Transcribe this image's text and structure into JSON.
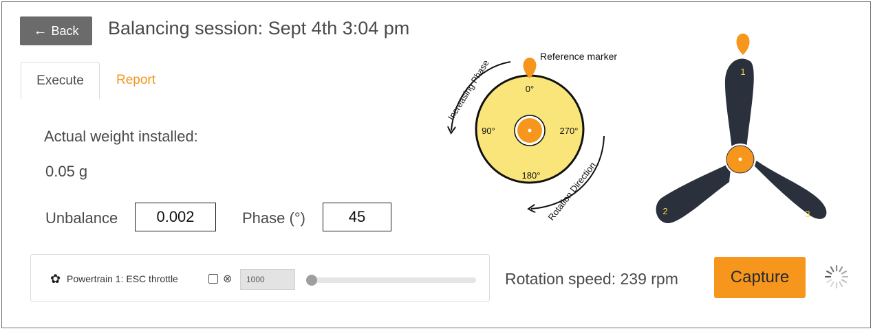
{
  "header": {
    "back_label": "Back",
    "title": "Balancing session: Sept 4th 3:04 pm"
  },
  "tabs": [
    {
      "label": "Execute",
      "active": true
    },
    {
      "label": "Report",
      "active": false
    }
  ],
  "weight": {
    "label": "Actual weight installed:",
    "value": "0.05 g"
  },
  "unbalance": {
    "label": "Unbalance",
    "value": "0.002"
  },
  "phase": {
    "label": "Phase (°)",
    "value": "45"
  },
  "throttle": {
    "label": "Powertrain 1: ESC throttle",
    "value": "1000",
    "slider_fraction": 0.0
  },
  "rotation_speed": "Rotation speed: 239 rpm",
  "capture_label": "Capture",
  "diagram": {
    "reference_marker": "Reference marker",
    "increasing_phase": "Increasing Phase",
    "rotation_direction": "Rotation Direction",
    "angles": [
      "0°",
      "90°",
      "180°",
      "270°"
    ],
    "blades": [
      "1",
      "2",
      "3"
    ]
  },
  "colors": {
    "accent": "#f7961d",
    "disk": "#f9e57a",
    "propeller": "#2b313c"
  }
}
